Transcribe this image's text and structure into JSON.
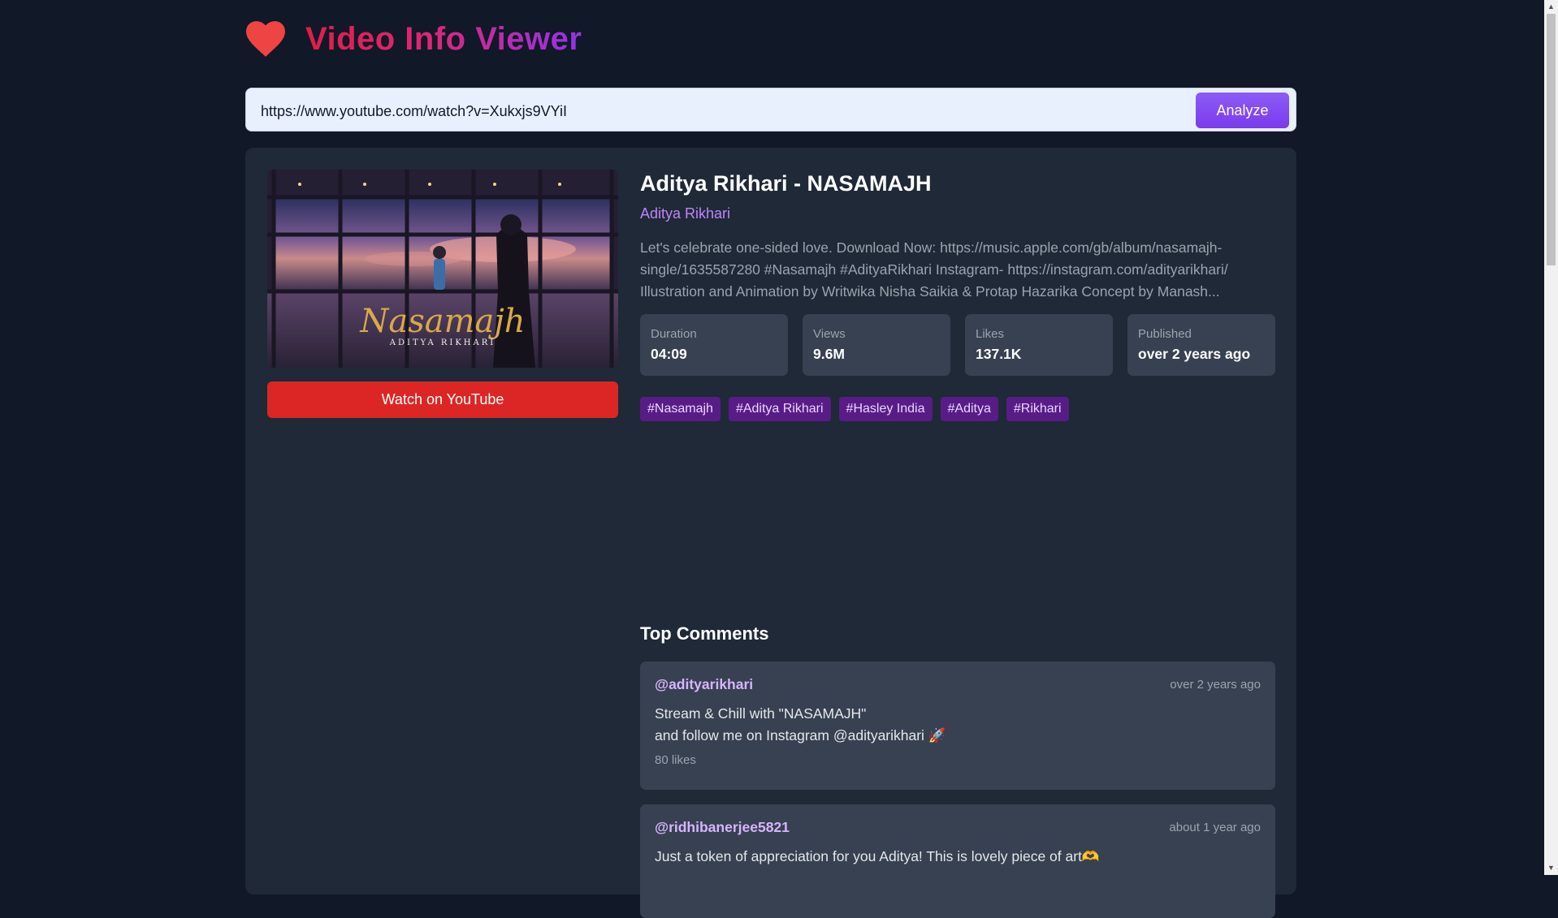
{
  "app": {
    "title": "Video Info Viewer",
    "logo_icon": "heart-icon",
    "accent": "#7c3aed"
  },
  "search": {
    "value": "https://www.youtube.com/watch?v=Xukxjs9VYiI",
    "button_label": "Analyze"
  },
  "video": {
    "title": "Aditya Rikhari - NASAMAJH",
    "channel": "Aditya Rikhari",
    "description": "Let's celebrate one-sided love. Download Now: https://music.apple.com/gb/album/nasamajh-single/1635587280 #Nasamajh #AdityaRikhari Instagram- https://instagram.com/adityarikhari/ Illustration and Animation by Writwika Nisha Saikia & Protap Hazarika Concept by Manash...",
    "thumbnail": {
      "title_text": "Nasamajh",
      "artist_text": "ADITYA RIKHARI"
    },
    "watch_button": "Watch on YouTube",
    "stats": [
      {
        "label": "Duration",
        "value": "04:09"
      },
      {
        "label": "Views",
        "value": "9.6M"
      },
      {
        "label": "Likes",
        "value": "137.1K"
      },
      {
        "label": "Published",
        "value": "over 2 years ago"
      }
    ],
    "tags": [
      "#Nasamajh",
      "#Aditya Rikhari",
      "#Hasley India",
      "#Aditya",
      "#Rikhari"
    ]
  },
  "comments": {
    "heading": "Top Comments",
    "items": [
      {
        "author": "@adityarikhari",
        "time": "over 2 years ago",
        "line1": "Stream & Chill with \"NASAMAJH\"",
        "line2": "and follow me on Instagram @adityarikhari 🚀",
        "likes": "80 likes"
      },
      {
        "author": "@ridhibanerjee5821",
        "time": "about 1 year ago",
        "line1": "Just a token of appreciation for you Aditya! This is lovely piece of art🫶",
        "line2": "",
        "likes": ""
      }
    ]
  }
}
